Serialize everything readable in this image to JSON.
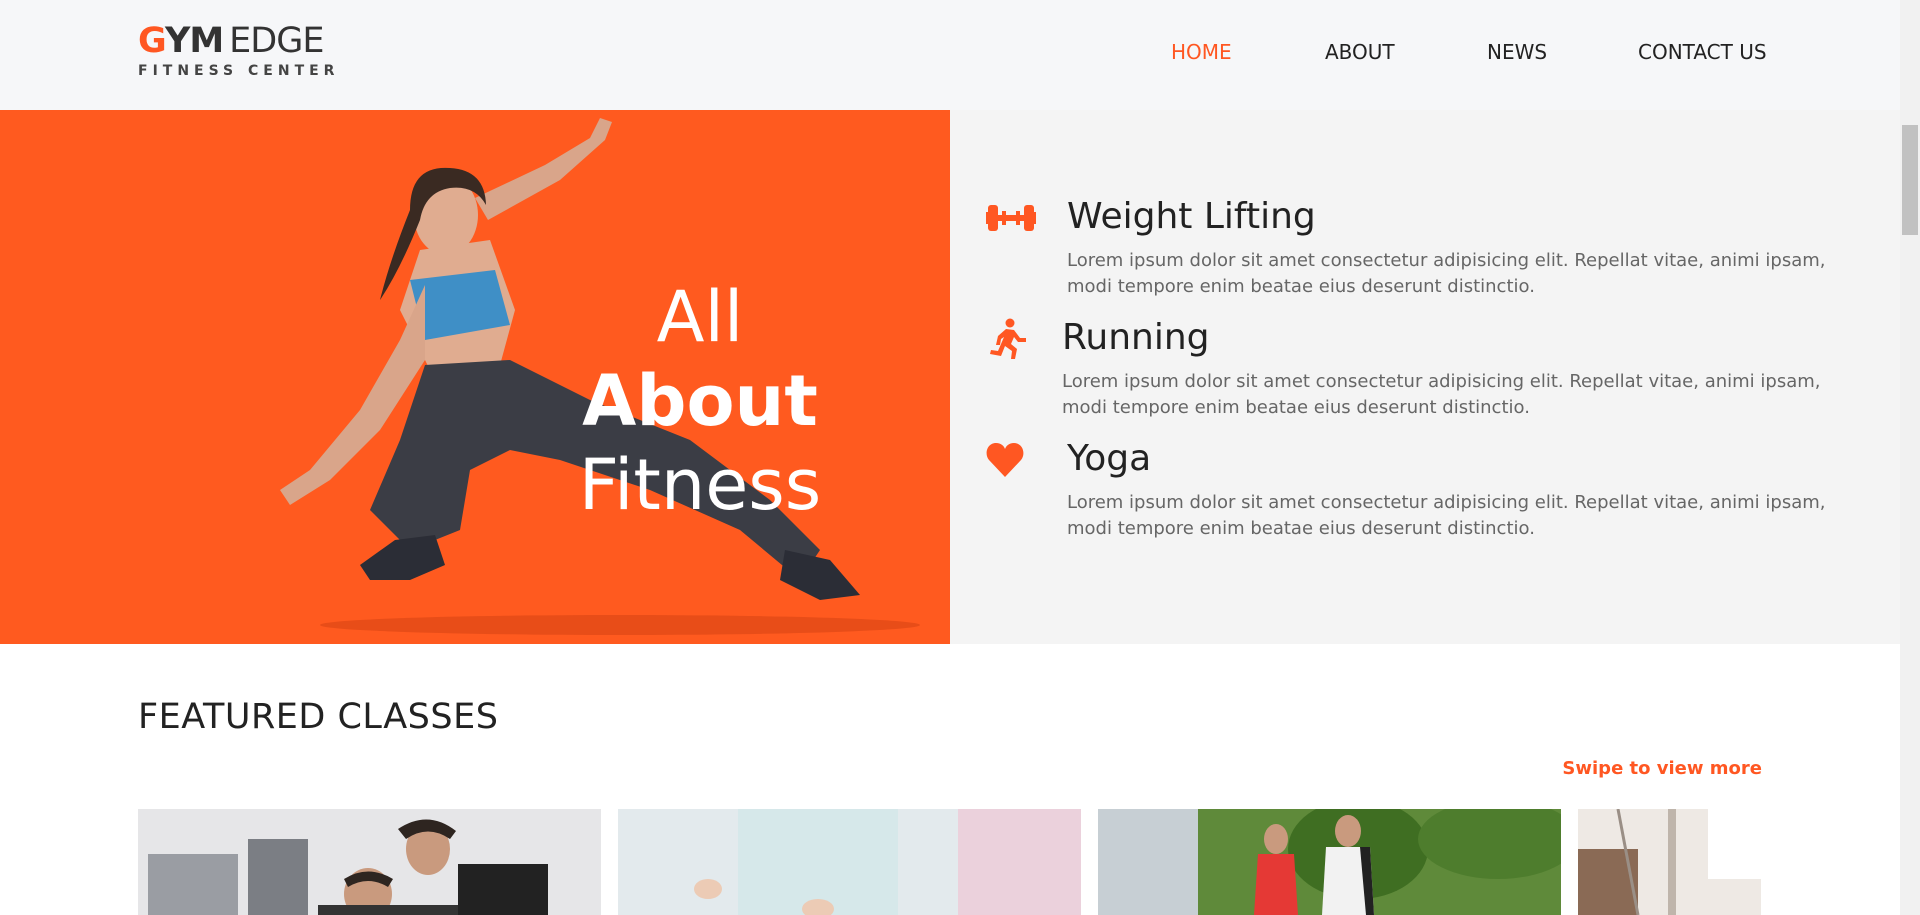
{
  "header": {
    "logo": {
      "g": "G",
      "ym": "YM",
      "edge": "EDGE",
      "subtitle": "FITNESS CENTER"
    },
    "nav": [
      {
        "label": "HOME",
        "active": true
      },
      {
        "label": "ABOUT",
        "active": false
      },
      {
        "label": "NEWS",
        "active": false
      },
      {
        "label": "CONTACT US",
        "active": false
      }
    ]
  },
  "hero": {
    "title_line1_a": "All",
    "title_line1_b": "About",
    "title_line2": "Fitness",
    "features": [
      {
        "icon": "dumbbell-icon",
        "title": "Weight Lifting",
        "text": "Lorem ipsum dolor sit amet consectetur adipisicing elit. Repellat vitae, animi ipsam, modi tempore enim beatae eius deserunt distinctio."
      },
      {
        "icon": "running-icon",
        "title": "Running",
        "text": "Lorem ipsum dolor sit amet consectetur adipisicing elit. Repellat vitae, animi ipsam, modi tempore enim beatae eius deserunt distinctio."
      },
      {
        "icon": "heart-icon",
        "title": "Yoga",
        "text": "Lorem ipsum dolor sit amet consectetur adipisicing elit. Repellat vitae, animi ipsam, modi tempore enim beatae eius deserunt distinctio."
      }
    ]
  },
  "featured": {
    "title": "FEATURED CLASSES",
    "swipe": "Swipe to view more"
  },
  "colors": {
    "accent": "#ff5722",
    "hero_bg": "#ff5a1f",
    "panel_bg": "#f4f4f4",
    "header_bg": "#f6f7f9"
  }
}
